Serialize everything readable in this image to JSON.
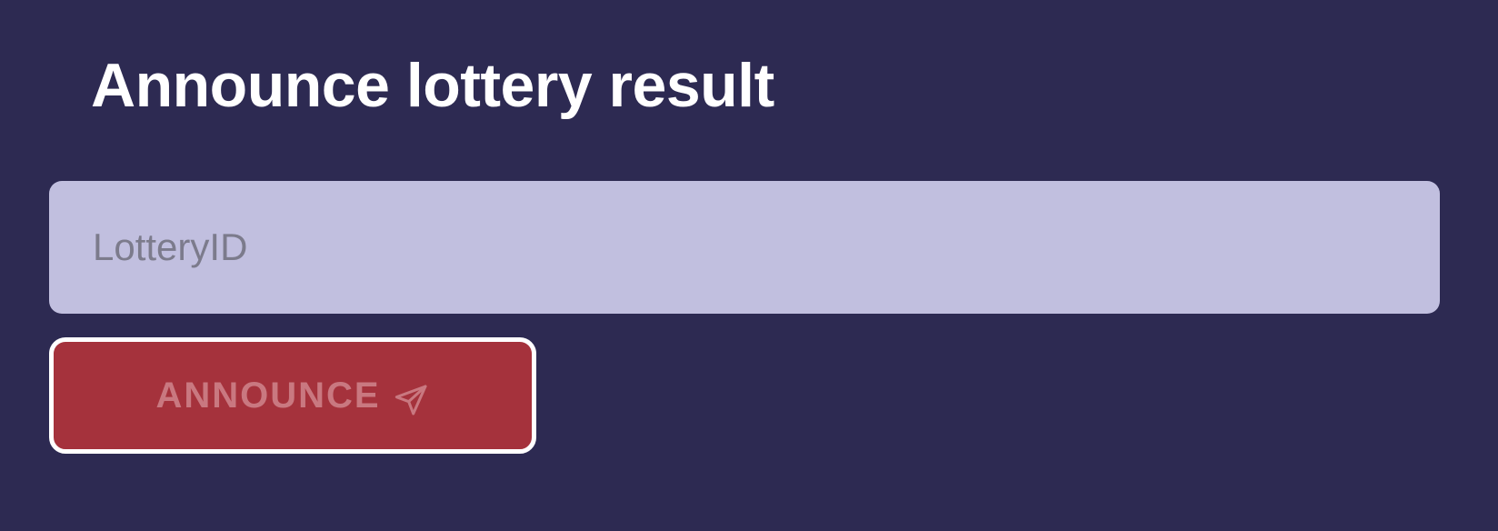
{
  "form": {
    "title": "Announce lottery result",
    "lottery_id": {
      "value": "",
      "placeholder": "LotteryID"
    },
    "announce_button": {
      "label": "ANNOUNCE",
      "icon": "send-icon"
    }
  },
  "colors": {
    "background": "#2d2a52",
    "input_background": "#c1bfdf",
    "button_background": "#a5323c",
    "button_border": "#ffffff",
    "button_text": "#c97880"
  }
}
